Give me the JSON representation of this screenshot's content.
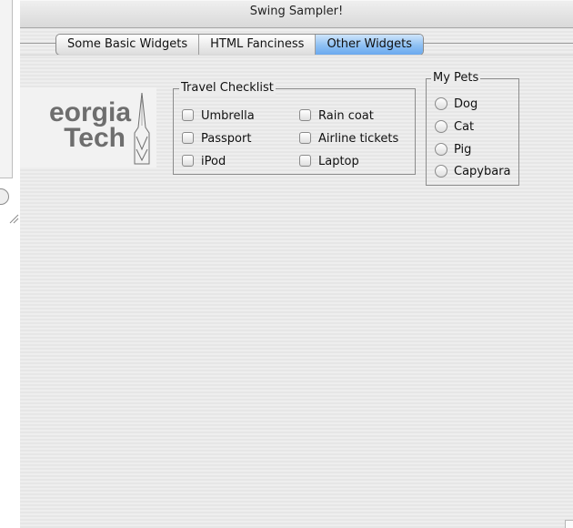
{
  "window": {
    "title": "Swing Sampler!"
  },
  "tabs": [
    {
      "label": "Some Basic Widgets",
      "active": false
    },
    {
      "label": "HTML Fanciness",
      "active": false
    },
    {
      "label": "Other Widgets",
      "active": true
    }
  ],
  "logo": {
    "line1": "eorgia",
    "line2": "Tech",
    "icon": "campanile-icon"
  },
  "travel_checklist": {
    "title": "Travel Checklist",
    "items": [
      {
        "label": "Umbrella",
        "checked": false
      },
      {
        "label": "Passport",
        "checked": false
      },
      {
        "label": "iPod",
        "checked": false
      },
      {
        "label": "Rain coat",
        "checked": false
      },
      {
        "label": "Airline tickets",
        "checked": false
      },
      {
        "label": "Laptop",
        "checked": false
      }
    ]
  },
  "my_pets": {
    "title": "My Pets",
    "options": [
      {
        "label": "Dog",
        "selected": false
      },
      {
        "label": "Cat",
        "selected": false
      },
      {
        "label": "Pig",
        "selected": false
      },
      {
        "label": "Capybara",
        "selected": false
      }
    ]
  },
  "colors": {
    "active_tab": "#8ec0f3",
    "logo_gray": "#6e6e6e"
  }
}
